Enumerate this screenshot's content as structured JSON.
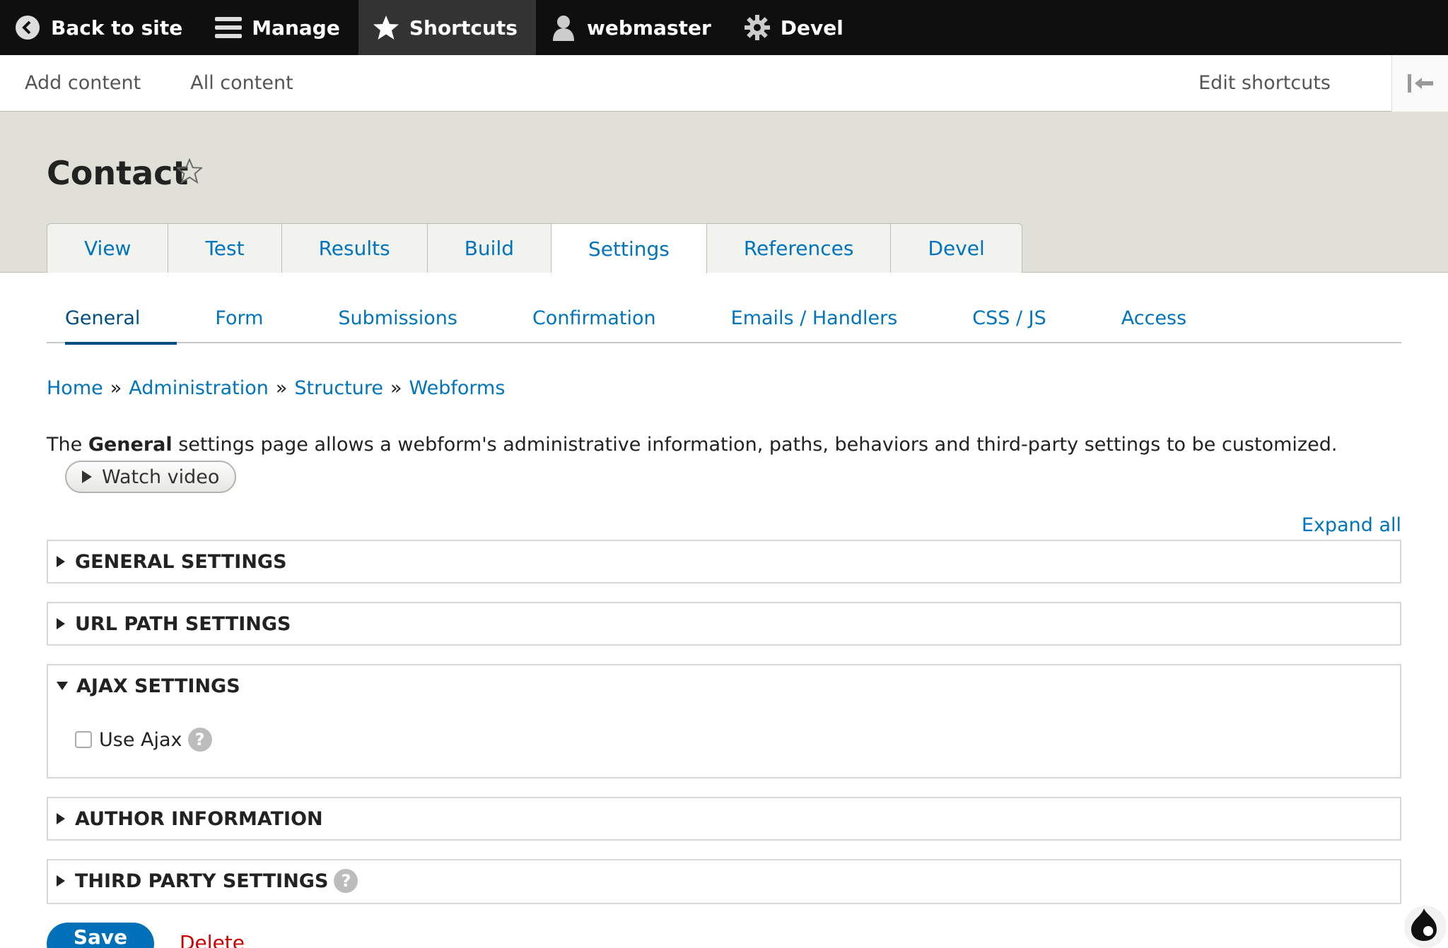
{
  "toolbar": {
    "back": "Back to site",
    "manage": "Manage",
    "shortcuts": "Shortcuts",
    "user": "webmaster",
    "devel": "Devel"
  },
  "tray": {
    "add_content": "Add content",
    "all_content": "All content",
    "edit_shortcuts": "Edit shortcuts"
  },
  "page": {
    "title": "Contact"
  },
  "tabs": [
    "View",
    "Test",
    "Results",
    "Build",
    "Settings",
    "References",
    "Devel"
  ],
  "subtabs": [
    "General",
    "Form",
    "Submissions",
    "Confirmation",
    "Emails / Handlers",
    "CSS / JS",
    "Access"
  ],
  "breadcrumb": [
    "Home",
    "Administration",
    "Structure",
    "Webforms"
  ],
  "breadcrumb_separator": "»",
  "description": {
    "before": "The ",
    "bold": "General",
    "after": " settings page allows a webform's administrative information, paths, behaviors and third-party settings to be customized."
  },
  "watch_video": "Watch video",
  "expand_all": "Expand all",
  "sections": [
    {
      "label": "GENERAL SETTINGS",
      "open": false
    },
    {
      "label": "URL PATH SETTINGS",
      "open": false
    },
    {
      "label": "AJAX SETTINGS",
      "open": true
    },
    {
      "label": "AUTHOR INFORMATION",
      "open": false
    },
    {
      "label": "THIRD PARTY SETTINGS",
      "open": false
    }
  ],
  "ajax": {
    "use_ajax_label": "Use Ajax",
    "checked": false
  },
  "help_glyph": "?",
  "actions": {
    "save": "Save",
    "delete": "Delete"
  },
  "colors": {
    "toolbar_bg": "#0f0f0f",
    "link": "#0074bd",
    "header_bg": "#e0e0d8",
    "save_button": "#0071b8",
    "delete": "#cc0000"
  }
}
